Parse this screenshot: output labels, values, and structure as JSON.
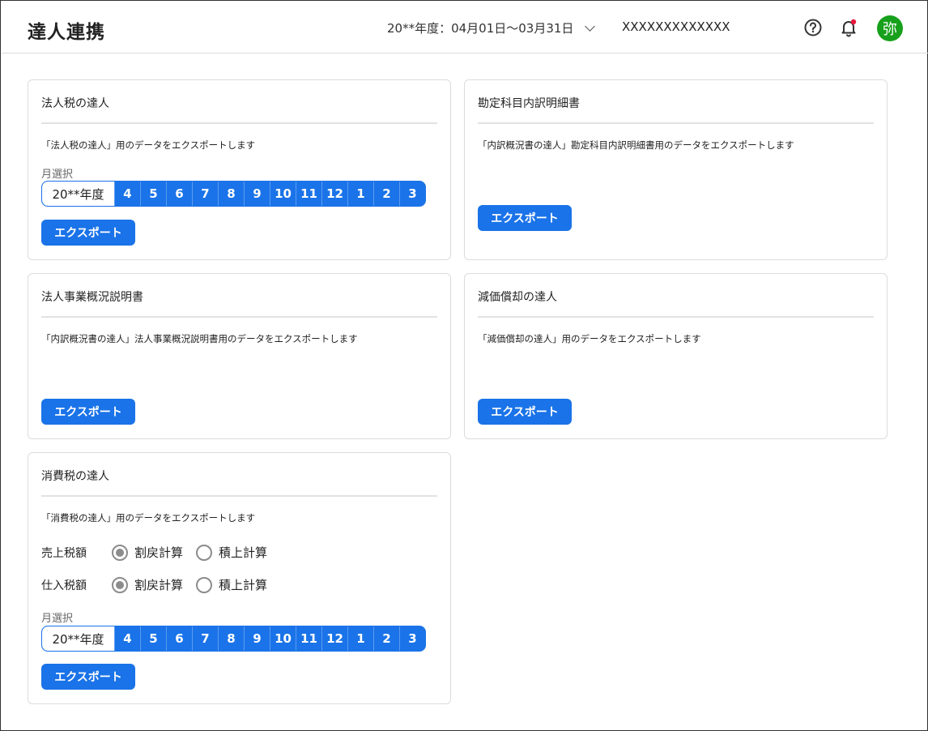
{
  "header": {
    "title": "達人連携",
    "period": "20**年度：04月01日〜03月31日",
    "company": "XXXXXXXXXXXXX",
    "help_icon": "help-circle-icon",
    "bell_icon": "bell-icon",
    "avatar_text": "弥",
    "avatar_color": "#17a01b"
  },
  "accent_color": "#1a73e8",
  "common": {
    "month_label": "月選択",
    "year_label": "20**年度",
    "months": [
      "4",
      "5",
      "6",
      "7",
      "8",
      "9",
      "10",
      "11",
      "12",
      "1",
      "2",
      "3"
    ],
    "export_label": "エクスポート"
  },
  "cards": {
    "corp_tax": {
      "title": "法人税の達人",
      "desc": "「法人税の達人」用のデータをエクスポートします"
    },
    "account_detail": {
      "title": "勘定科目内訳明細書",
      "desc": "「内訳概況書の達人」勘定科目内訳明細書用のデータをエクスポートします"
    },
    "business_summary": {
      "title": "法人事業概況説明書",
      "desc": "「内訳概況書の達人」法人事業概況説明書用のデータをエクスポートします"
    },
    "depreciation": {
      "title": "減価償却の達人",
      "desc": "「減価償却の達人」用のデータをエクスポートします"
    },
    "consumption_tax": {
      "title": "消費税の達人",
      "desc": "「消費税の達人」用のデータをエクスポートします",
      "sales_tax_label": "売上税額",
      "purchase_tax_label": "仕入税額",
      "option_warimodoshi": "割戻計算",
      "option_tsumiage": "積上計算",
      "sales_selected": "割戻計算",
      "purchase_selected": "割戻計算"
    }
  }
}
